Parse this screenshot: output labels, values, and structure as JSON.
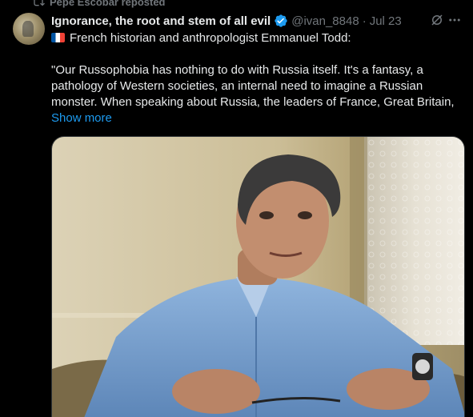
{
  "repost": {
    "label": "Pepe Escobar reposted"
  },
  "author": {
    "name": "Ignorance, the root and stem of all evil",
    "handle": "@ivan_8848",
    "separator": "·",
    "date": "Jul 23"
  },
  "tweet": {
    "line1": "French historian and anthropologist Emmanuel Todd:",
    "quote": "\"Our Russophobia has nothing to do with Russia itself. It's a fantasy, a pathology of Western societies, an internal need to imagine a Russian monster. When speaking about Russia, the leaders of France, Great Britain,",
    "show_more": "Show more"
  },
  "colors": {
    "accent": "#1d9bf0",
    "muted": "#71767b",
    "text": "#e7e9ea",
    "background": "#000000"
  },
  "icons": [
    "repost-icon",
    "verified-badge-icon",
    "grok-icon",
    "more-icon",
    "french-flag-icon"
  ]
}
